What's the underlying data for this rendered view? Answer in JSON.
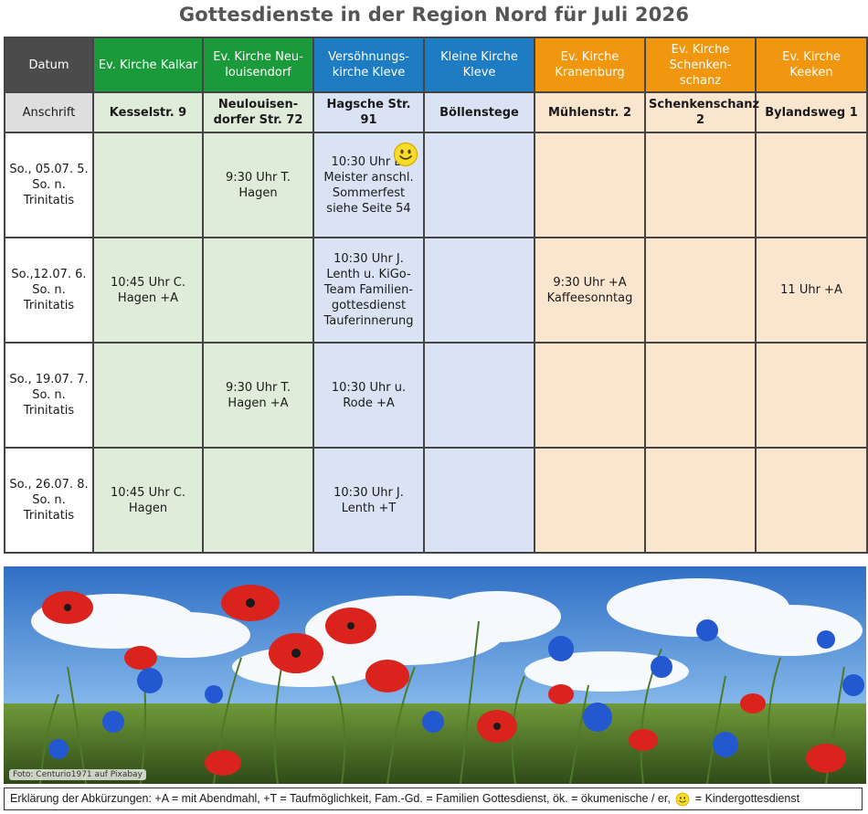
{
  "title": "Gottesdienste in der Region Nord für Juli 2026",
  "header": {
    "datum": "Datum",
    "columns": [
      "Ev. Kirche Kalkar",
      "Ev. Kirche Neu-louisendorf",
      "Versöhnungs-kirche Kleve",
      "Kleine Kirche Kleve",
      "Ev. Kirche Kranenburg",
      "Ev. Kirche Schenken-schanz",
      "Ev. Kirche Keeken"
    ],
    "column_colors": [
      "#1a9a3a",
      "#1a9a3a",
      "#1e7cc2",
      "#1e7cc2",
      "#f0960f",
      "#f0960f",
      "#f0960f"
    ]
  },
  "addresses": {
    "label": "Anschrift",
    "values": [
      "Kesselstr. 9",
      "Neulouisen-dorfer Str. 72",
      "Hagsche Str. 91",
      "Böllenstege",
      "Mühlenstr. 2",
      "Schenkenschanz 2",
      "Bylandsweg 1"
    ]
  },
  "rows": [
    {
      "date": "So., 05.07. 5. So. n. Trinitatis",
      "cells": [
        "",
        "9:30 Uhr T. Hagen",
        "10:30 Uhr B. Meister anschl. Sommerfest siehe Seite 54",
        "",
        "",
        "",
        ""
      ]
    },
    {
      "date": "So.,12.07. 6. So. n. Trinitatis",
      "cells": [
        "10:45 Uhr C. Hagen +A",
        "",
        "10:30 Uhr J. Lenth u. KiGo-Team Familien-gottesdienst Tauferinnerung",
        "",
        "9:30 Uhr +A Kaffeesonntag",
        "",
        "11 Uhr +A"
      ]
    },
    {
      "date": "So., 19.07. 7. So. n. Trinitatis",
      "cells": [
        "",
        "9:30 Uhr T. Hagen +A",
        "10:30 Uhr u. Rode +A",
        "",
        "",
        "",
        ""
      ]
    },
    {
      "date": "So., 26.07. 8. So. n. Trinitatis",
      "cells": [
        "10:45 Uhr C. Hagen",
        "",
        "10:30 Uhr J. Lenth +T",
        "",
        "",
        "",
        ""
      ]
    }
  ],
  "photo_credit": "Foto: Centurio1971 auf Pixabay",
  "legend": {
    "text_before": "Erklärung der Abkürzungen: +A = mit Abendmahl, +T = Taufmöglichkeit, Fam.-Gd. = Familien Gottesdienst, ök. = ökumenische / er,",
    "text_after": "= Kindergottesdienst",
    "smiley_icon": "smiley-icon"
  }
}
